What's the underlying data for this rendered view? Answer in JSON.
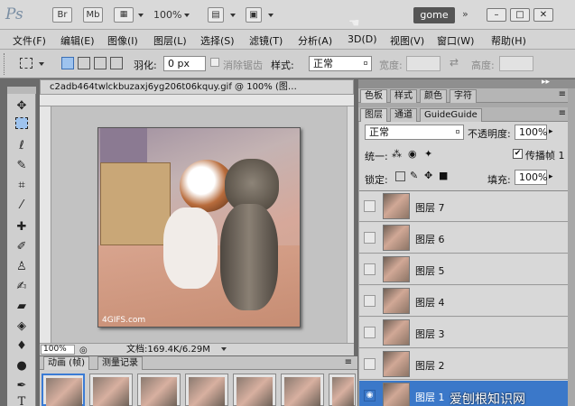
{
  "app": {
    "logo": "Ps",
    "bridge_label": "Br",
    "minibridge_label": "Mb",
    "zoom_level": "100%",
    "workspace_label": "gome",
    "window_buttons": [
      "–",
      "□",
      "✕"
    ]
  },
  "menu": [
    "文件(F)",
    "编辑(E)",
    "图像(I)",
    "图层(L)",
    "选择(S)",
    "滤镜(T)",
    "分析(A)",
    "3D(D)",
    "视图(V)",
    "窗口(W)",
    "帮助(H)"
  ],
  "options": {
    "feather_label": "羽化:",
    "feather_value": "0 px",
    "antialias_label": "消除锯齿",
    "style_label": "样式:",
    "style_value": "正常",
    "width_label": "宽度:",
    "height_label": "高度:"
  },
  "tools": [
    "move-tool",
    "marquee-tool",
    "lasso-tool",
    "quick-select-tool",
    "crop-tool",
    "eyedropper-tool",
    "healing-tool",
    "brush-tool",
    "stamp-tool",
    "history-brush-tool",
    "eraser-tool",
    "gradient-tool",
    "blur-tool",
    "dodge-tool",
    "pen-tool",
    "type-tool"
  ],
  "document": {
    "tab_title": "c2adb464twlckbuzaxj6yg206t06kquy.gif @ 100% (图…",
    "zoom": "100%",
    "status": "文档:169.4K/6.29M",
    "watermark": "4GIFS.com"
  },
  "animation": {
    "tab_animation": "动画 (帧)",
    "tab_history": "测量记录",
    "frame_count": 7,
    "selected_frame": 1
  },
  "panels": {
    "top_tabs": [
      "色板",
      "样式",
      "颜色",
      "字符"
    ],
    "layer_tabs": [
      "图层",
      "通道",
      "GuideGuide"
    ],
    "blend_mode": "正常",
    "opacity_label": "不透明度:",
    "opacity_value": "100%",
    "unify_label": "统一:",
    "propagate_label": "传播帧 1",
    "lock_label": "锁定:",
    "fill_label": "填充:",
    "fill_value": "100%",
    "layers": [
      "图层 7",
      "图层 6",
      "图层 5",
      "图层 4",
      "图层 3",
      "图层 2",
      "图层 1"
    ],
    "selected_layer": "图层 1"
  },
  "watermark_site": "爱刨根知识网"
}
